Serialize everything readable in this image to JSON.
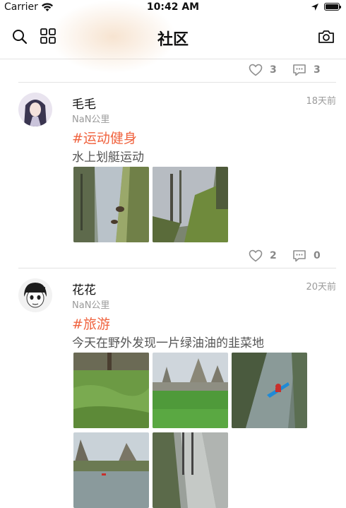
{
  "status_bar": {
    "carrier": "Carrier",
    "time": "10:42 AM"
  },
  "nav": {
    "title": "社区",
    "left_icons": [
      "search-icon",
      "grid-icon"
    ],
    "right_icon": "camera-icon"
  },
  "previous_post": {
    "likes": "3",
    "comments": "3"
  },
  "posts": [
    {
      "name": "毛毛",
      "time_ago": "18天前",
      "distance": "NaN公里",
      "tag": "#运动健身",
      "content": "水上划艇运动",
      "photos": [
        "canal-photo",
        "canal-photo"
      ],
      "likes": "2",
      "comments": "0"
    },
    {
      "name": "花花",
      "time_ago": "20天前",
      "distance": "NaN公里",
      "tag": "#旅游",
      "content": "今天在野外发现一片绿油油的韭菜地",
      "photos": [
        "garlic-field-photo",
        "park-photo",
        "kayak-photo",
        "lake-photo",
        "path-photo"
      ]
    }
  ],
  "colors": {
    "tag": "#f0633f",
    "secondary_text": "#9a9a9a",
    "divider": "#e3e3e3"
  }
}
